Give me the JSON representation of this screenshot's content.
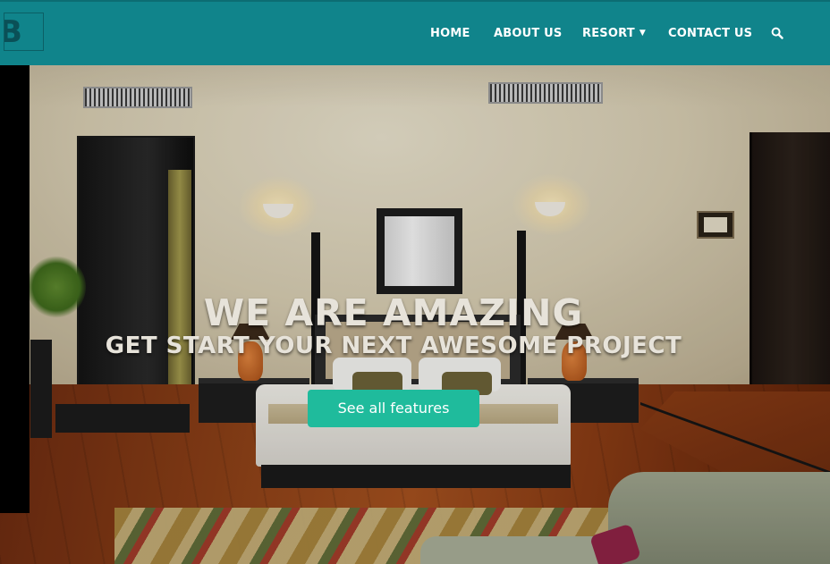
{
  "navbar": {
    "background_color": "#10848b",
    "logo_icon": "logo-icon",
    "links": [
      {
        "label": "HOME"
      },
      {
        "label": "ABOUT US"
      },
      {
        "label": "RESORT",
        "icon": "caret-down-icon"
      },
      {
        "label": "CONTACT US"
      }
    ],
    "search_icon": "search-icon"
  },
  "hero": {
    "headline": "WE ARE AMAZING",
    "subheadline": "GET START YOUR NEXT AWESOME PROJECT",
    "cta_label": "See all features",
    "cta_color": "#1fbb9c",
    "background_image": "hotel-room-photo"
  }
}
